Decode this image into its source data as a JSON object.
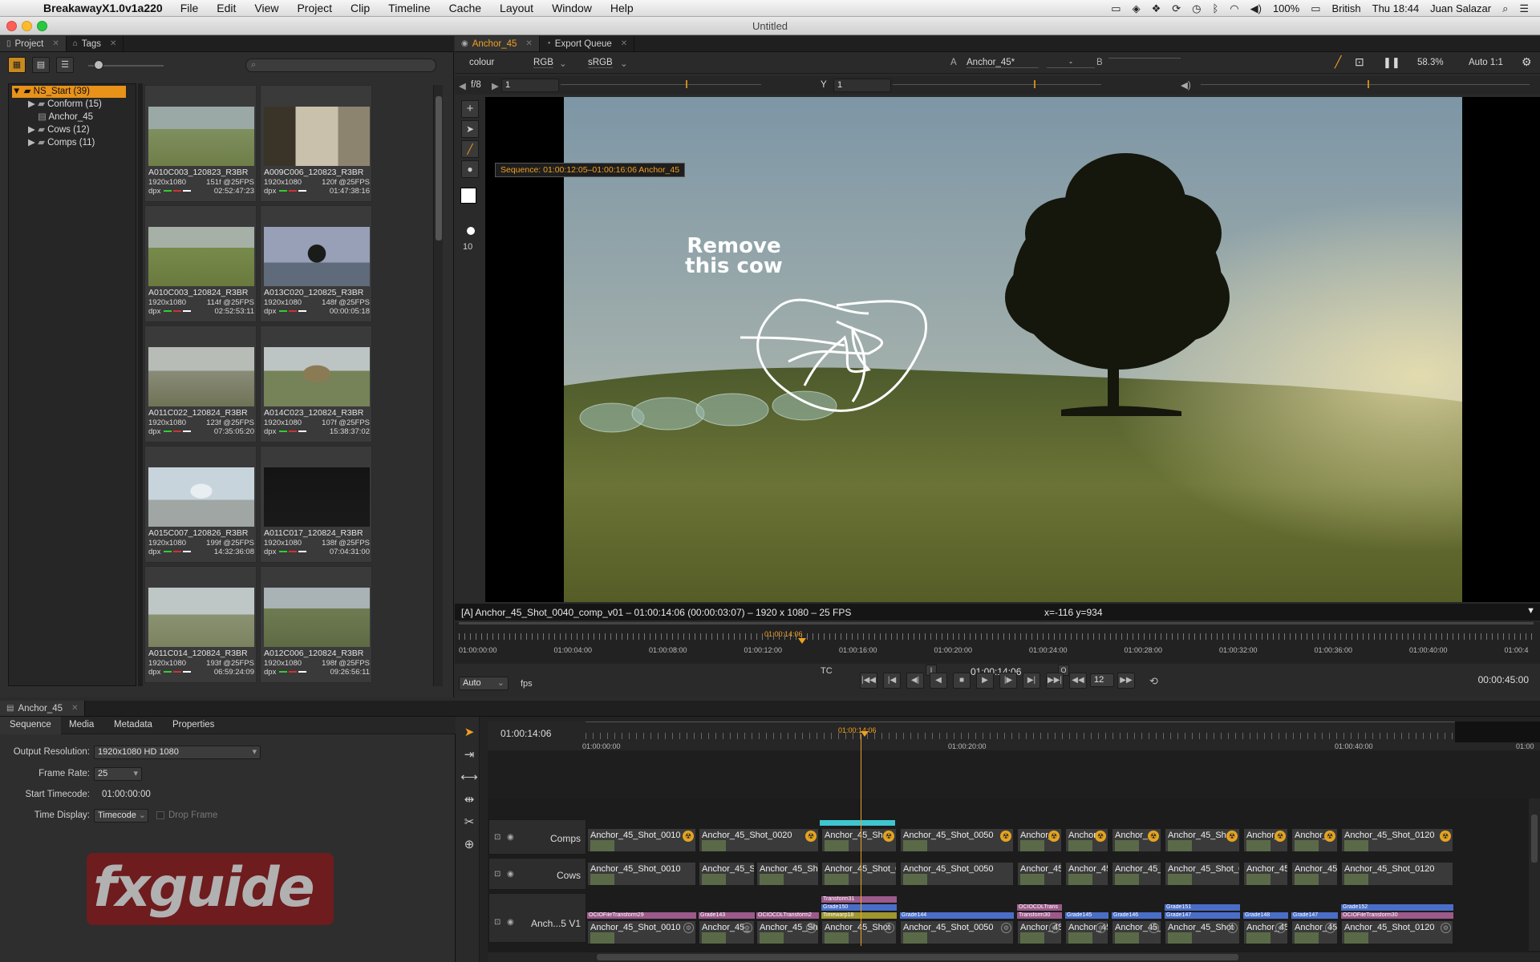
{
  "menubar": {
    "app_name": "BreakawayX1.0v1a220",
    "items": [
      "File",
      "Edit",
      "View",
      "Project",
      "Clip",
      "Timeline",
      "Cache",
      "Layout",
      "Window",
      "Help"
    ],
    "battery": "100%",
    "input_source": "British",
    "clock": "Thu 18:44",
    "user": "Juan Salazar"
  },
  "window": {
    "title": "Untitled"
  },
  "project_panel": {
    "tabs": [
      "Project",
      "Tags"
    ],
    "tree": [
      {
        "label": "NS_Start (39)",
        "selected": true
      },
      {
        "label": "Conform (15)"
      },
      {
        "label": "Anchor_45"
      },
      {
        "label": "Cows (12)"
      },
      {
        "label": "Comps (11)"
      }
    ],
    "clips": [
      {
        "name": "A010C003_120823_R3BR",
        "res": "1920x1080",
        "dur": "151f @25FPS",
        "fmt": "dpx",
        "tc": "02:52:47:23"
      },
      {
        "name": "A009C006_120823_R3BR",
        "res": "1920x1080",
        "dur": "120f @25FPS",
        "fmt": "dpx",
        "tc": "01:47:38:16"
      },
      {
        "name": "A010C003_120824_R3BR",
        "res": "1920x1080",
        "dur": "114f @25FPS",
        "fmt": "dpx",
        "tc": "02:52:53:11"
      },
      {
        "name": "A013C020_120825_R3BR",
        "res": "1920x1080",
        "dur": "148f @25FPS",
        "fmt": "dpx",
        "tc": "00:00:05:18"
      },
      {
        "name": "A011C022_120824_R3BR",
        "res": "1920x1080",
        "dur": "123f @25FPS",
        "fmt": "dpx",
        "tc": "07:35:05:20"
      },
      {
        "name": "A014C023_120824_R3BR",
        "res": "1920x1080",
        "dur": "107f @25FPS",
        "fmt": "dpx",
        "tc": "15:38:37:02"
      },
      {
        "name": "A015C007_120826_R3BR",
        "res": "1920x1080",
        "dur": "199f @25FPS",
        "fmt": "dpx",
        "tc": "14:32:36:08"
      },
      {
        "name": "A011C017_120824_R3BR",
        "res": "1920x1080",
        "dur": "138f @25FPS",
        "fmt": "dpx",
        "tc": "07:04:31:00"
      },
      {
        "name": "A011C014_120824_R3BR",
        "res": "1920x1080",
        "dur": "193f @25FPS",
        "fmt": "dpx",
        "tc": "06:59:24:09"
      },
      {
        "name": "A012C006_120824_R3BR",
        "res": "1920x1080",
        "dur": "198f @25FPS",
        "fmt": "dpx",
        "tc": "09:26:56:11"
      }
    ]
  },
  "viewer": {
    "tabs": [
      "Anchor_45",
      "Export Queue"
    ],
    "toolbar": {
      "colour": "colour",
      "channels": "RGB",
      "lut": "sRGB",
      "a_label": "A",
      "a_value": "Anchor_45*",
      "compare": "-",
      "b_label": "B",
      "zoom": "58.3%",
      "scale": "Auto 1:1"
    },
    "ruler": {
      "fstop": "f/8",
      "x_val": "1",
      "y_label": "Y",
      "y_val": "1"
    },
    "brush_size": "10",
    "tooltip": "Sequence: 01:00:12:05–01:00:16:06 Anchor_45",
    "annotation": {
      "line1": "Remove",
      "line2": "this cow"
    },
    "info_left": "[A] Anchor_45_Shot_0040_comp_v01 – 01:00:14:06 (00:00:03:07) – 1920 x 1080 – 25 FPS",
    "info_coords": "x=-116 y=934",
    "playhead_tc": "01:00:14:06",
    "scrub_ticks": [
      "01:00:00:00",
      "01:00:04:00",
      "01:00:08:00",
      "01:00:12:00",
      "01:00:16:00",
      "01:00:20:00",
      "01:00:24:00",
      "01:00:28:00",
      "01:00:32:00",
      "01:00:36:00",
      "01:00:40:00",
      "01:00:4"
    ],
    "transport": {
      "fps_mode": "Auto",
      "fps_label": "fps",
      "tc_mode": "TC",
      "in_label": "I",
      "out_label": "O",
      "current_tc": "01:00:14:06",
      "step": "12",
      "duration": "00:00:45:00"
    }
  },
  "sequence_panel": {
    "tab": "Anchor_45",
    "subtabs": [
      "Sequence",
      "Media",
      "Metadata",
      "Properties"
    ],
    "output_resolution_label": "Output Resolution:",
    "output_resolution": "1920x1080 HD 1080",
    "frame_rate_label": "Frame Rate:",
    "frame_rate": "25",
    "start_tc_label": "Start Timecode:",
    "start_tc": "01:00:00:00",
    "time_display_label": "Time Display:",
    "time_display": "Timecode",
    "drop_frame": "Drop Frame",
    "watermark": "fxguide"
  },
  "timeline": {
    "current_tc": "01:00:14:06",
    "playhead_tc": "01:00:14:06",
    "ticks": [
      "01:00:00:00",
      "01:00:20:00",
      "01:00:40:00",
      "01:00"
    ],
    "tracks": {
      "comps": {
        "name": "Comps",
        "clips": [
          "Anchor_45_Shot_0010",
          "Anchor_45_Shot_0020",
          "Anchor_45_Sh",
          "Anchor_45_Shot_0050",
          "Anchor_",
          "Anchor_",
          "Anchor_45",
          "Anchor_45_Shot",
          "Anchor_4",
          "Anchor_4",
          "Anchor_45_Shot_0120"
        ]
      },
      "cows": {
        "name": "Cows",
        "clips": [
          "Anchor_45_Shot_0010",
          "Anchor_45_Sh",
          "Anchor_45_Shot",
          "Anchor_45_Shot_0(",
          "Anchor_45_Shot_0050",
          "Anchor_45",
          "Anchor_45",
          "Anchor_45_Sl",
          "Anchor_45_Shot_0(",
          "Anchor_45",
          "Anchor_45_",
          "Anchor_45_Shot_0120"
        ]
      },
      "v1": {
        "name": "Anch...5 V1",
        "clips": [
          "Anchor_45_Shot_0010",
          "Anchor_45_",
          "Anchor_45_Shot",
          "Anchor_45_Shot",
          "Anchor_45_Shot_0050",
          "Anchor_45",
          "Anchor_45",
          "Anchor_45_Sl",
          "Anchor_45_Shot",
          "Anchor_45",
          "Anchor_45_",
          "Anchor_45_Shot_0120"
        ],
        "effects": [
          "OCIOFileTransform29",
          "Grade143",
          "OCIOCDLTransform2",
          "Transform31",
          "Grade150",
          "Timewarp18",
          "Grade144",
          "OCIOCDLTrans",
          "Transform30",
          "Grade145",
          "Grade146",
          "Grade151",
          "Grade147",
          "Grade148",
          "Grade147",
          "Grade152",
          "OCIOFileTransform30"
        ]
      }
    }
  },
  "colors": {
    "accent": "#f0a020",
    "selection": "#e8921a",
    "playhead": "#e8a030"
  }
}
